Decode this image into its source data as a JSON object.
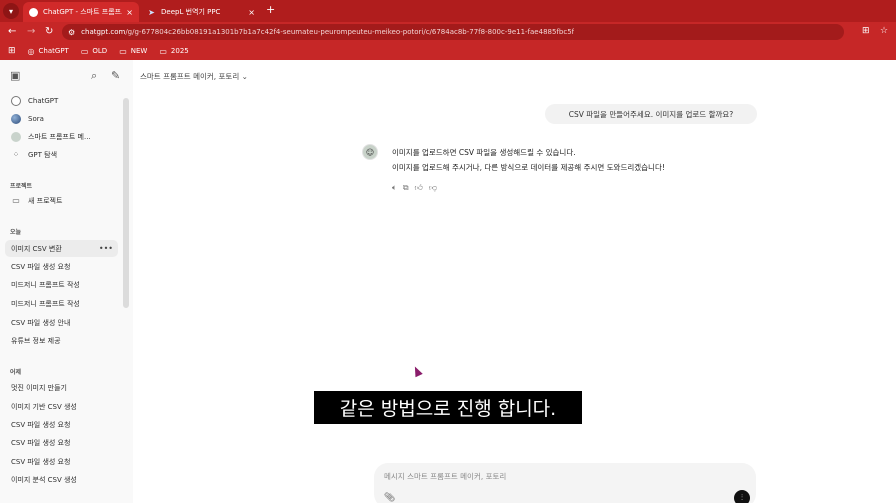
{
  "browser": {
    "tabs": [
      {
        "title": "ChatGPT - 스마트 프롬프트 메",
        "close": "×"
      },
      {
        "title": "DeepL 번역기 PPC",
        "close": "×"
      }
    ],
    "new_tab": "+",
    "url_host": "chatgpt.com",
    "url_path": "/g/g-677804c26bb08191a1301b7b1a7c42f4-seumateu-peurompeuteu-meikeo-potori/c/6784ac8b-77f8-800c-9e11-fae4885fbc5f",
    "bookmarks": [
      {
        "label": "ChatGPT",
        "icon": "chatgpt-icon"
      },
      {
        "label": "OLD",
        "icon": "folder-icon"
      },
      {
        "label": "NEW",
        "icon": "folder-icon"
      },
      {
        "label": "2025",
        "icon": "folder-icon"
      }
    ]
  },
  "sidebar": {
    "top_items": [
      {
        "label": "ChatGPT",
        "icon": "chatgpt-icon"
      },
      {
        "label": "Sora",
        "icon": "sora-icon"
      },
      {
        "label": "스마트 프롬프트 메...",
        "icon": "gpt-avatar-icon"
      },
      {
        "label": "GPT 탐색",
        "icon": "grid-icon"
      }
    ],
    "projects_header": "프로젝트",
    "new_project": "새 프로젝트",
    "today_header": "오늘",
    "today_items": [
      "이미지 CSV 변환",
      "CSV 파일 생성 요청",
      "미드저니 프롬프트 작성",
      "미드저니 프롬프트 작성",
      "CSV 파일 생성 안내",
      "유튜브 정보 제공"
    ],
    "yesterday_header": "어제",
    "yesterday_items": [
      "멋진 이미지 만들기",
      "이미지 기반 CSV 생성",
      "CSV 파일 생성 요청",
      "CSV 파일 생성 요청",
      "CSV 파일 생성 요청",
      "이미지 분석 CSV 생성"
    ]
  },
  "main": {
    "gpt_title": "스마트 프롬프트 메이커, 포토리",
    "user_message": "CSV 파일을 만들어주세요. 이미지를 업로드 할까요?",
    "assistant_lines": [
      "이미지를 업로드하면 CSV 파일을 생성해드릴 수 있습니다.",
      "이미지를 업로드해 주시거나, 다른 방식으로 데이터를 제공해 주시면 도와드리겠습니다!"
    ],
    "composer_placeholder": "메시지 스마트 프롬프트 메이커, 포토리"
  },
  "overlay": {
    "subtitle": "같은 방법으로 진행 합니다."
  }
}
